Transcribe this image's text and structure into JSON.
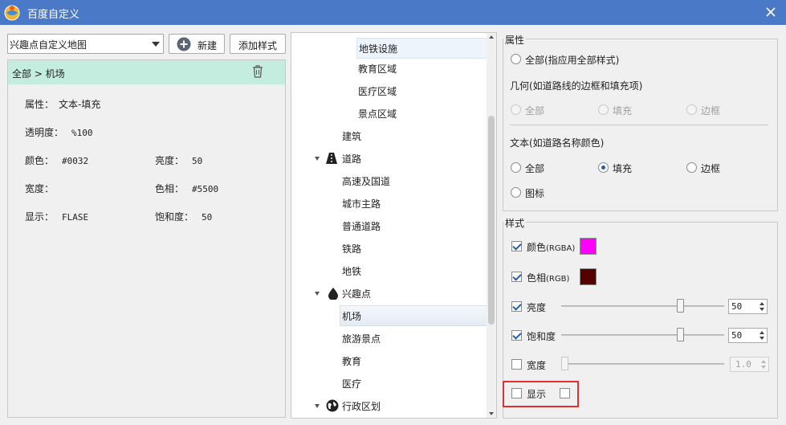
{
  "window": {
    "title": "百度自定义",
    "close_icon": "close-icon"
  },
  "toolbar": {
    "map_select_value": "兴趣点自定义地图",
    "new_label": "新建",
    "add_style_label": "添加样式"
  },
  "left_panel": {
    "breadcrumb": "全部 > 机场",
    "attr_label": "属性：",
    "attr_value": "文本-填充",
    "opacity_label": "透明度：",
    "opacity_value": "%100",
    "color_label": "颜色：",
    "color_value": "#0032",
    "brightness_label": "亮度：",
    "brightness_value": "50",
    "width_label": "宽度：",
    "width_value": "",
    "hue_label": "色相：",
    "hue_value": "#5500",
    "display_label": "显示：",
    "display_value": "FLASE",
    "saturation_label": "饱和度：",
    "saturation_value": "50"
  },
  "tree": {
    "items": [
      {
        "label": "地铁设施",
        "level": 2,
        "selected": false
      },
      {
        "label": "教育区域",
        "level": 2
      },
      {
        "label": "医疗区域",
        "level": 2
      },
      {
        "label": "景点区域",
        "level": 2
      },
      {
        "label": "建筑",
        "level": 1
      },
      {
        "label": "道路",
        "level": 0,
        "icon": "road-icon"
      },
      {
        "label": "高速及国道",
        "level": 1
      },
      {
        "label": "城市主路",
        "level": 1
      },
      {
        "label": "普通道路",
        "level": 1
      },
      {
        "label": "铁路",
        "level": 1
      },
      {
        "label": "地铁",
        "level": 1
      },
      {
        "label": "兴趣点",
        "level": 0,
        "icon": "drop-icon"
      },
      {
        "label": "机场",
        "level": 1,
        "selected": true
      },
      {
        "label": "旅游景点",
        "level": 1
      },
      {
        "label": "教育",
        "level": 1
      },
      {
        "label": "医疗",
        "level": 1
      },
      {
        "label": "行政区划",
        "level": 0,
        "icon": "globe-icon"
      }
    ]
  },
  "attributes": {
    "group_title": "属性",
    "all_label": "全部(指应用全部样式)",
    "geometry_title": "几何(如道路线的边框和填充项)",
    "geo_all": "全部",
    "geo_fill": "填充",
    "geo_border": "边框",
    "text_title": "文本(如道路名称颜色)",
    "text_all": "全部",
    "text_fill": "填充",
    "text_border": "边框",
    "text_icon": "图标"
  },
  "style": {
    "group_title": "样式",
    "color_label": "颜色",
    "color_unit": "(RGBA)",
    "color_swatch": "#ff00ff",
    "hue_label": "色相",
    "hue_unit": "(RGB)",
    "hue_swatch": "#550000",
    "brightness_label": "亮度",
    "brightness_value": "50",
    "saturation_label": "饱和度",
    "saturation_value": "50",
    "width_label": "宽度",
    "width_value": "1.0",
    "display_label": "显示"
  },
  "colors": {
    "titlebar": "#4a7ac7",
    "selected_header": "#c4ecdf",
    "highlight": "#e03030"
  }
}
